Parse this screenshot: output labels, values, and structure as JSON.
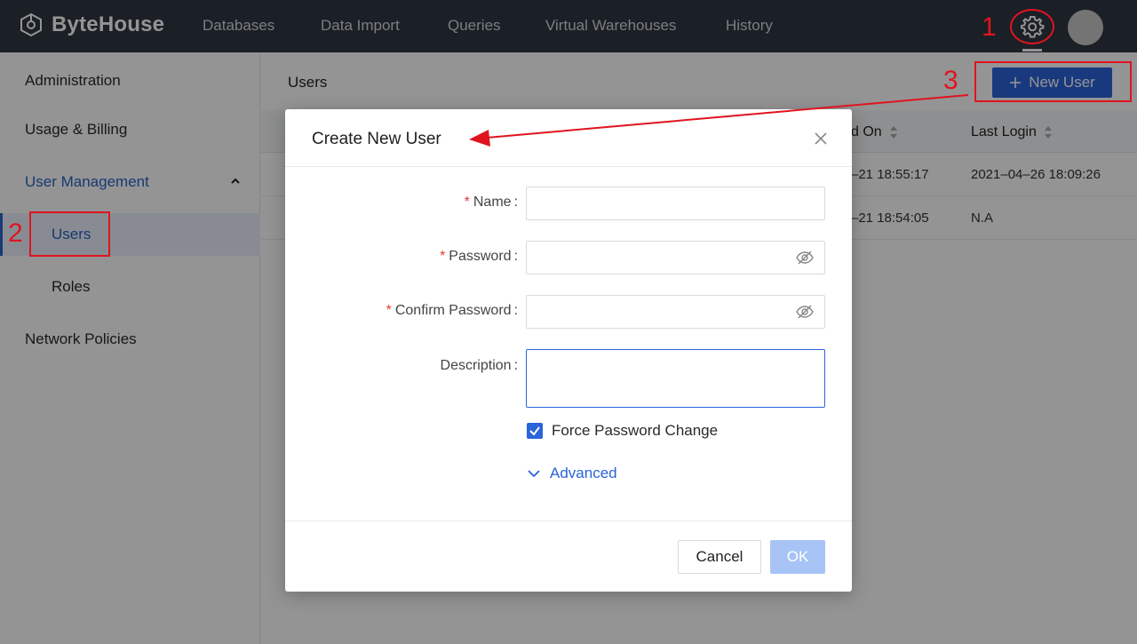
{
  "app": {
    "brand": "ByteHouse",
    "nav": [
      "Databases",
      "Data Import",
      "Queries",
      "Virtual Warehouses",
      "History"
    ]
  },
  "sidebar": {
    "administration": "Administration",
    "usage_billing": "Usage & Billing",
    "user_management": "User Management",
    "users": "Users",
    "roles": "Roles",
    "network_policies": "Network Policies"
  },
  "content": {
    "title": "Users",
    "new_user_label": "New User",
    "columns": {
      "created_on_partial": "d On",
      "last_login": "Last Login"
    },
    "rows": [
      {
        "created_on_partial": "–21 18:55:17",
        "last_login": "2021–04–26 18:09:26"
      },
      {
        "created_on_partial": "–21 18:54:05",
        "last_login": "N.A"
      }
    ]
  },
  "modal": {
    "title": "Create New User",
    "fields": {
      "name_label": "Name",
      "password_label": "Password",
      "confirm_password_label": "Confirm Password",
      "description_label": "Description",
      "name_value": "",
      "password_value": "",
      "confirm_password_value": "",
      "description_value": ""
    },
    "required_mark": "*",
    "colon": ":",
    "force_password_change_label": "Force Password Change",
    "force_password_change_checked": true,
    "advanced_label": "Advanced",
    "cancel_label": "Cancel",
    "ok_label": "OK"
  },
  "annotations": {
    "step1": "1",
    "step2": "2",
    "step3": "3",
    "color": "#e0141e"
  },
  "colors": {
    "topnav": "#2f3643",
    "accent": "#2b63d9",
    "ok_disabled": "#a8c4f7"
  }
}
